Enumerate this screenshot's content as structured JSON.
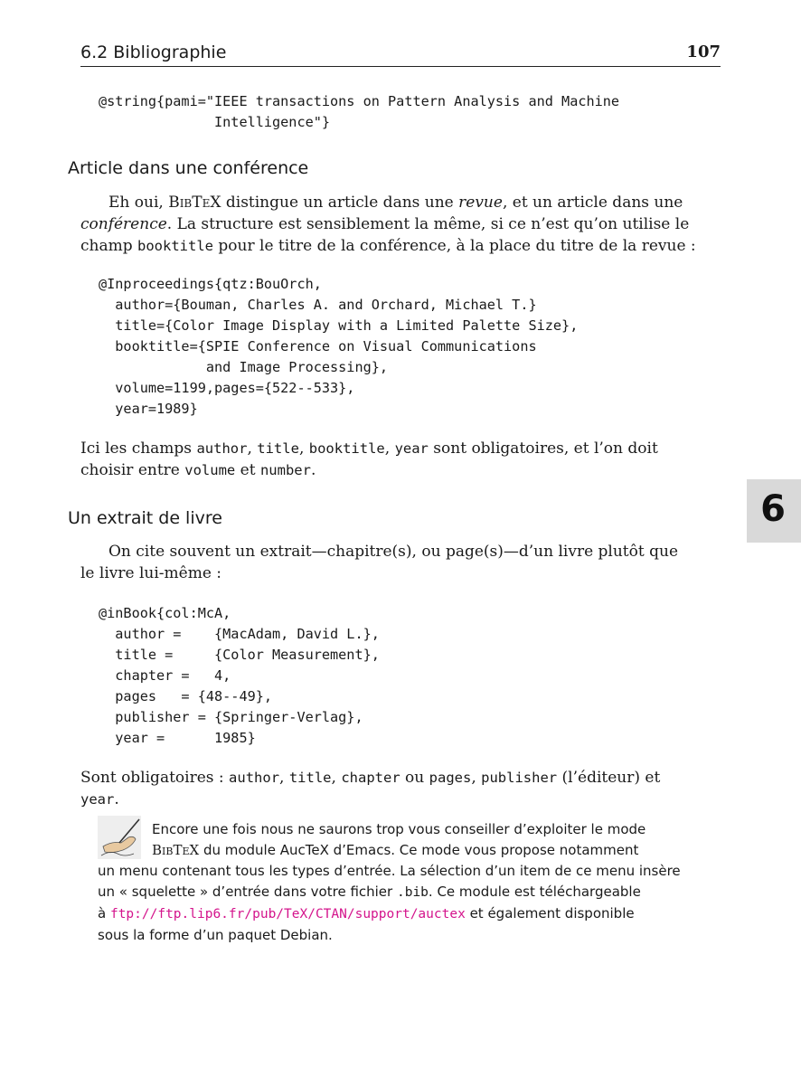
{
  "header": {
    "section": "6.2 Bibliographie",
    "page_number": "107"
  },
  "code1": "@string{pami=\"IEEE transactions on Pattern Analysis and Machine\n              Intelligence\"}",
  "heading1": "Article dans une conférence",
  "p1": {
    "l1a": "Eh oui, ",
    "bibtex": "BibTeX",
    "l1b": " distingue un article dans une ",
    "revue": "revue",
    "l1c": ", et un article dans une",
    "conference": "conférence",
    "l2": ". La structure est sensiblement la même, si ce n’est qu’on utilise le",
    "l3a": "champ ",
    "booktitle": "booktitle",
    "l3b": " pour le titre de la conférence, à la place du titre de la revue :"
  },
  "code2": "@Inproceedings{qtz:BouOrch,\n  author={Bouman, Charles A. and Orchard, Michael T.}\n  title={Color Image Display with a Limited Palette Size},\n  booktitle={SPIE Conference on Visual Communications\n             and Image Processing},\n  volume=1199,pages={522--533},\n  year=1989}",
  "p2": {
    "a": "Ici les champs ",
    "f1": "author",
    "s1": ", ",
    "f2": "title",
    "s2": ", ",
    "f3": "booktitle",
    "s3": ", ",
    "f4": "year",
    "b": " sont obligatoires, et l’on doit",
    "c": "choisir entre ",
    "f5": "volume",
    "d": " et ",
    "f6": "number",
    "e": "."
  },
  "chapter_tab": "6",
  "heading2": "Un extrait de livre",
  "p3": {
    "l1": "On cite souvent un extrait—chapitre(s), ou page(s)—d’un livre plutôt que",
    "l2": "le livre lui-même :"
  },
  "code3": "@inBook{col:McA,\n  author =    {MacAdam, David L.},\n  title =     {Color Measurement},\n  chapter =   4,\n  pages   = {48--49},\n  publisher = {Springer-Verlag},\n  year =      1985}",
  "p4": {
    "a": "Sont obligatoires : ",
    "f1": "author",
    "s1": ", ",
    "f2": "title",
    "s2": ", ",
    "f3": "chapter",
    "o": " ou ",
    "f4": "pages",
    "s3": ", ",
    "f5": "publisher",
    "b": " (l’éditeur) et",
    "f6": "year",
    "e": "."
  },
  "tip": {
    "l1": "Encore une fois nous ne saurons trop vous conseiller d’exploiter le mode",
    "bibtex": "BibTeX",
    "l2a": " du module Auc",
    "tex": "TeX",
    "l2b": " d’Emacs. Ce mode vous propose notamment",
    "l3": "un menu contenant tous les types d’entrée. La sélection d’un item de ce menu insère",
    "l4a": "un « squelette » d’entrée dans votre fichier ",
    "bib": ".bib",
    "l4b": ". Ce module est téléchargeable",
    "l5a": "à ",
    "url": "ftp://ftp.lip6.fr/pub/TeX/CTAN/support/auctex",
    "l5b": " et également disponible",
    "l6": "sous la forme d’un paquet Debian."
  }
}
